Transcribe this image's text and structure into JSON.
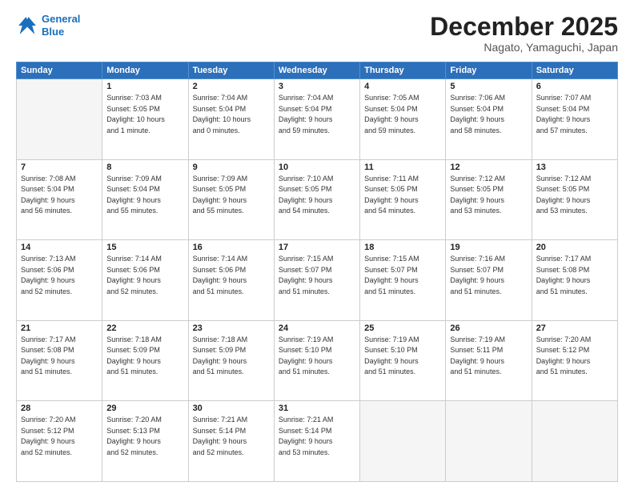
{
  "logo": {
    "line1": "General",
    "line2": "Blue"
  },
  "title": "December 2025",
  "subtitle": "Nagato, Yamaguchi, Japan",
  "days_of_week": [
    "Sunday",
    "Monday",
    "Tuesday",
    "Wednesday",
    "Thursday",
    "Friday",
    "Saturday"
  ],
  "weeks": [
    [
      {
        "day": "",
        "info": ""
      },
      {
        "day": "1",
        "info": "Sunrise: 7:03 AM\nSunset: 5:05 PM\nDaylight: 10 hours\nand 1 minute."
      },
      {
        "day": "2",
        "info": "Sunrise: 7:04 AM\nSunset: 5:04 PM\nDaylight: 10 hours\nand 0 minutes."
      },
      {
        "day": "3",
        "info": "Sunrise: 7:04 AM\nSunset: 5:04 PM\nDaylight: 9 hours\nand 59 minutes."
      },
      {
        "day": "4",
        "info": "Sunrise: 7:05 AM\nSunset: 5:04 PM\nDaylight: 9 hours\nand 59 minutes."
      },
      {
        "day": "5",
        "info": "Sunrise: 7:06 AM\nSunset: 5:04 PM\nDaylight: 9 hours\nand 58 minutes."
      },
      {
        "day": "6",
        "info": "Sunrise: 7:07 AM\nSunset: 5:04 PM\nDaylight: 9 hours\nand 57 minutes."
      }
    ],
    [
      {
        "day": "7",
        "info": "Sunrise: 7:08 AM\nSunset: 5:04 PM\nDaylight: 9 hours\nand 56 minutes."
      },
      {
        "day": "8",
        "info": "Sunrise: 7:09 AM\nSunset: 5:04 PM\nDaylight: 9 hours\nand 55 minutes."
      },
      {
        "day": "9",
        "info": "Sunrise: 7:09 AM\nSunset: 5:05 PM\nDaylight: 9 hours\nand 55 minutes."
      },
      {
        "day": "10",
        "info": "Sunrise: 7:10 AM\nSunset: 5:05 PM\nDaylight: 9 hours\nand 54 minutes."
      },
      {
        "day": "11",
        "info": "Sunrise: 7:11 AM\nSunset: 5:05 PM\nDaylight: 9 hours\nand 54 minutes."
      },
      {
        "day": "12",
        "info": "Sunrise: 7:12 AM\nSunset: 5:05 PM\nDaylight: 9 hours\nand 53 minutes."
      },
      {
        "day": "13",
        "info": "Sunrise: 7:12 AM\nSunset: 5:05 PM\nDaylight: 9 hours\nand 53 minutes."
      }
    ],
    [
      {
        "day": "14",
        "info": "Sunrise: 7:13 AM\nSunset: 5:06 PM\nDaylight: 9 hours\nand 52 minutes."
      },
      {
        "day": "15",
        "info": "Sunrise: 7:14 AM\nSunset: 5:06 PM\nDaylight: 9 hours\nand 52 minutes."
      },
      {
        "day": "16",
        "info": "Sunrise: 7:14 AM\nSunset: 5:06 PM\nDaylight: 9 hours\nand 51 minutes."
      },
      {
        "day": "17",
        "info": "Sunrise: 7:15 AM\nSunset: 5:07 PM\nDaylight: 9 hours\nand 51 minutes."
      },
      {
        "day": "18",
        "info": "Sunrise: 7:15 AM\nSunset: 5:07 PM\nDaylight: 9 hours\nand 51 minutes."
      },
      {
        "day": "19",
        "info": "Sunrise: 7:16 AM\nSunset: 5:07 PM\nDaylight: 9 hours\nand 51 minutes."
      },
      {
        "day": "20",
        "info": "Sunrise: 7:17 AM\nSunset: 5:08 PM\nDaylight: 9 hours\nand 51 minutes."
      }
    ],
    [
      {
        "day": "21",
        "info": "Sunrise: 7:17 AM\nSunset: 5:08 PM\nDaylight: 9 hours\nand 51 minutes."
      },
      {
        "day": "22",
        "info": "Sunrise: 7:18 AM\nSunset: 5:09 PM\nDaylight: 9 hours\nand 51 minutes."
      },
      {
        "day": "23",
        "info": "Sunrise: 7:18 AM\nSunset: 5:09 PM\nDaylight: 9 hours\nand 51 minutes."
      },
      {
        "day": "24",
        "info": "Sunrise: 7:19 AM\nSunset: 5:10 PM\nDaylight: 9 hours\nand 51 minutes."
      },
      {
        "day": "25",
        "info": "Sunrise: 7:19 AM\nSunset: 5:10 PM\nDaylight: 9 hours\nand 51 minutes."
      },
      {
        "day": "26",
        "info": "Sunrise: 7:19 AM\nSunset: 5:11 PM\nDaylight: 9 hours\nand 51 minutes."
      },
      {
        "day": "27",
        "info": "Sunrise: 7:20 AM\nSunset: 5:12 PM\nDaylight: 9 hours\nand 51 minutes."
      }
    ],
    [
      {
        "day": "28",
        "info": "Sunrise: 7:20 AM\nSunset: 5:12 PM\nDaylight: 9 hours\nand 52 minutes."
      },
      {
        "day": "29",
        "info": "Sunrise: 7:20 AM\nSunset: 5:13 PM\nDaylight: 9 hours\nand 52 minutes."
      },
      {
        "day": "30",
        "info": "Sunrise: 7:21 AM\nSunset: 5:14 PM\nDaylight: 9 hours\nand 52 minutes."
      },
      {
        "day": "31",
        "info": "Sunrise: 7:21 AM\nSunset: 5:14 PM\nDaylight: 9 hours\nand 53 minutes."
      },
      {
        "day": "",
        "info": ""
      },
      {
        "day": "",
        "info": ""
      },
      {
        "day": "",
        "info": ""
      }
    ]
  ]
}
